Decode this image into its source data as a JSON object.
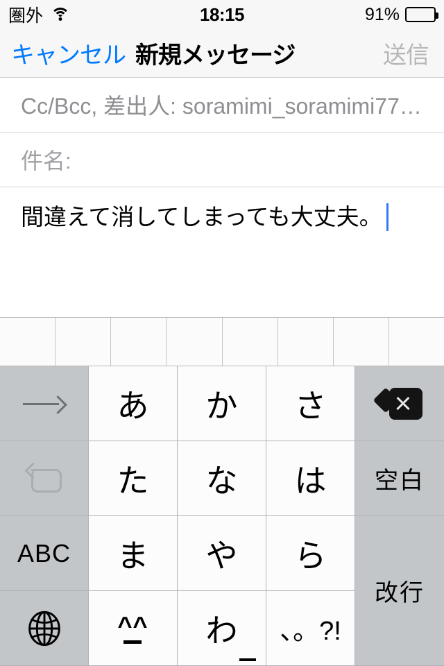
{
  "status_bar": {
    "carrier": "圏外",
    "wifi_icon": "wifi-icon",
    "time": "18:15",
    "battery_percent": "91%",
    "battery_level": 91,
    "battery_icon": "battery-icon"
  },
  "nav_bar": {
    "cancel_label": "キャンセル",
    "title": "新規メッセージ",
    "send_label": "送信",
    "cancel_color": "#007aff",
    "send_color": "#b7b7b7"
  },
  "compose": {
    "recipients_field": "Cc/Bcc, 差出人: soramimi_soramimi77…",
    "subject_field": "件名:",
    "body_text": "間違えて消してしまっても大丈夫。",
    "caret_color": "#3478f6"
  },
  "predictive_bar": {
    "cells": [
      "",
      "",
      "",
      "",
      "",
      "",
      "",
      ""
    ]
  },
  "keyboard": {
    "type": "japanese-kana-10key",
    "rows": [
      [
        {
          "name": "next-candidate-key",
          "icon": "arrow-right-icon",
          "label": "→",
          "style": "dark"
        },
        {
          "name": "kana-key-a",
          "label": "あ",
          "style": "light"
        },
        {
          "name": "kana-key-ka",
          "label": "か",
          "style": "light"
        },
        {
          "name": "kana-key-sa",
          "label": "さ",
          "style": "light"
        },
        {
          "name": "delete-key",
          "icon": "backspace-icon",
          "label": "",
          "style": "dark"
        }
      ],
      [
        {
          "name": "undo-key",
          "icon": "undo-icon",
          "label": "↺",
          "style": "dark"
        },
        {
          "name": "kana-key-ta",
          "label": "た",
          "style": "light"
        },
        {
          "name": "kana-key-na",
          "label": "な",
          "style": "light"
        },
        {
          "name": "kana-key-ha",
          "label": "は",
          "style": "light"
        },
        {
          "name": "space-key",
          "label": "空白",
          "style": "dark"
        }
      ],
      [
        {
          "name": "abc-mode-key",
          "label": "ABC",
          "style": "dark"
        },
        {
          "name": "kana-key-ma",
          "label": "ま",
          "style": "light"
        },
        {
          "name": "kana-key-ya",
          "label": "や",
          "style": "light"
        },
        {
          "name": "kana-key-ra",
          "label": "ら",
          "style": "light"
        },
        {
          "name": "return-key",
          "label": "改行",
          "style": "dark"
        }
      ],
      [
        {
          "name": "globe-key",
          "icon": "globe-icon",
          "label": "",
          "style": "dark"
        },
        {
          "name": "emoticon-key",
          "label": "^_^",
          "style": "light"
        },
        {
          "name": "kana-key-wa",
          "label": "わ",
          "style": "light"
        },
        {
          "name": "punctuation-key",
          "label": "、。?!",
          "style": "light"
        }
      ]
    ]
  }
}
